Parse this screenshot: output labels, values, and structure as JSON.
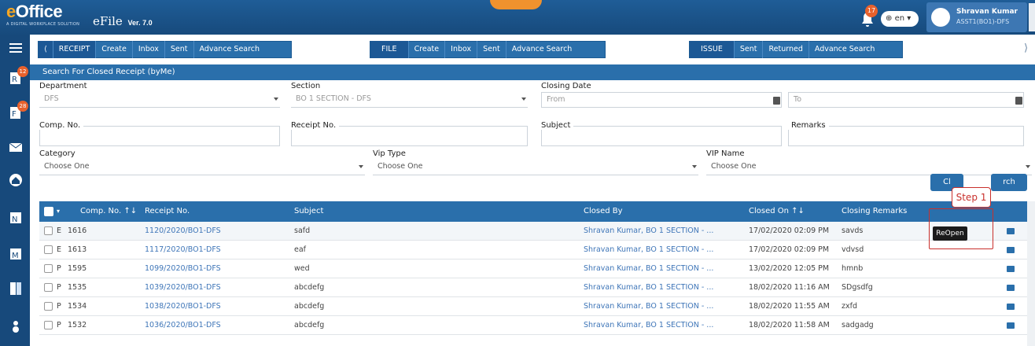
{
  "app": {
    "logo": "eOffice",
    "tagline": "A DIGITAL WORKPLACE SOLUTION",
    "module": "eFile",
    "version": "Ver. 7.0"
  },
  "header": {
    "notif_count": "17",
    "language": "en",
    "user_name": "Shravan Kumar",
    "user_designation": "ASST1(BO1)-DFS"
  },
  "sidebar": {
    "badges": [
      "12",
      "28"
    ]
  },
  "menus": {
    "receipt": {
      "title": "RECEIPT",
      "items": [
        "Create",
        "Inbox",
        "Sent",
        "Advance Search"
      ]
    },
    "file": {
      "title": "FILE",
      "items": [
        "Create",
        "Inbox",
        "Sent",
        "Advance Search"
      ]
    },
    "issue": {
      "title": "ISSUE",
      "items": [
        "Sent",
        "Returned",
        "Advance Search"
      ]
    }
  },
  "page": {
    "title": "Search For Closed Receipt (byMe)"
  },
  "form": {
    "department": {
      "label": "Department",
      "value": "DFS"
    },
    "section": {
      "label": "Section",
      "value": "BO 1 SECTION - DFS"
    },
    "closing_date": {
      "label": "Closing Date",
      "from": "From",
      "to": "To"
    },
    "comp_no": {
      "label": "Comp. No."
    },
    "receipt_no": {
      "label": "Receipt No."
    },
    "subject": {
      "label": "Subject"
    },
    "remarks": {
      "label": "Remarks"
    },
    "category": {
      "label": "Category",
      "value": "Choose One"
    },
    "vip_type": {
      "label": "Vip Type",
      "value": "Choose One"
    },
    "vip_name": {
      "label": "VIP Name",
      "value": "Choose One"
    }
  },
  "buttons": {
    "clear": "Cl",
    "search": "rch"
  },
  "annotation": {
    "step": "Step 1",
    "tooltip": "ReOpen"
  },
  "table": {
    "headers": {
      "comp_no": "Comp. No.",
      "receipt_no": "Receipt No.",
      "subject": "Subject",
      "closed_by": "Closed By",
      "closed_on": "Closed On",
      "closing_remarks": "Closing Remarks"
    },
    "rows": [
      {
        "type": "E",
        "comp_no": "1616",
        "receipt_no": "1120/2020/BO1-DFS",
        "subject": "safd",
        "closed_by": "Shravan Kumar, BO 1 SECTION - ...",
        "closed_on": "17/02/2020 02:09 PM",
        "remarks": "savds"
      },
      {
        "type": "E",
        "comp_no": "1613",
        "receipt_no": "1117/2020/BO1-DFS",
        "subject": "eaf",
        "closed_by": "Shravan Kumar, BO 1 SECTION - ...",
        "closed_on": "17/02/2020 02:09 PM",
        "remarks": "vdvsd"
      },
      {
        "type": "P",
        "comp_no": "1595",
        "receipt_no": "1099/2020/BO1-DFS",
        "subject": "wed",
        "closed_by": "Shravan Kumar, BO 1 SECTION - ...",
        "closed_on": "13/02/2020 12:05 PM",
        "remarks": "hmnb"
      },
      {
        "type": "P",
        "comp_no": "1535",
        "receipt_no": "1039/2020/BO1-DFS",
        "subject": "abcdefg",
        "closed_by": "Shravan Kumar, BO 1 SECTION - ...",
        "closed_on": "18/02/2020 11:16 AM",
        "remarks": "SDgsdfg"
      },
      {
        "type": "P",
        "comp_no": "1534",
        "receipt_no": "1038/2020/BO1-DFS",
        "subject": "abcdefg",
        "closed_by": "Shravan Kumar, BO 1 SECTION - ...",
        "closed_on": "18/02/2020 11:55 AM",
        "remarks": "zxfd"
      },
      {
        "type": "P",
        "comp_no": "1532",
        "receipt_no": "1036/2020/BO1-DFS",
        "subject": "abcdefg",
        "closed_by": "Shravan Kumar, BO 1 SECTION - ...",
        "closed_on": "18/02/2020 11:58 AM",
        "remarks": "sadgadg"
      }
    ]
  },
  "colors": {
    "primary": "#2a6fab",
    "header": "#1f5d97",
    "accent": "#f0922e",
    "annotation": "#c9302c"
  }
}
